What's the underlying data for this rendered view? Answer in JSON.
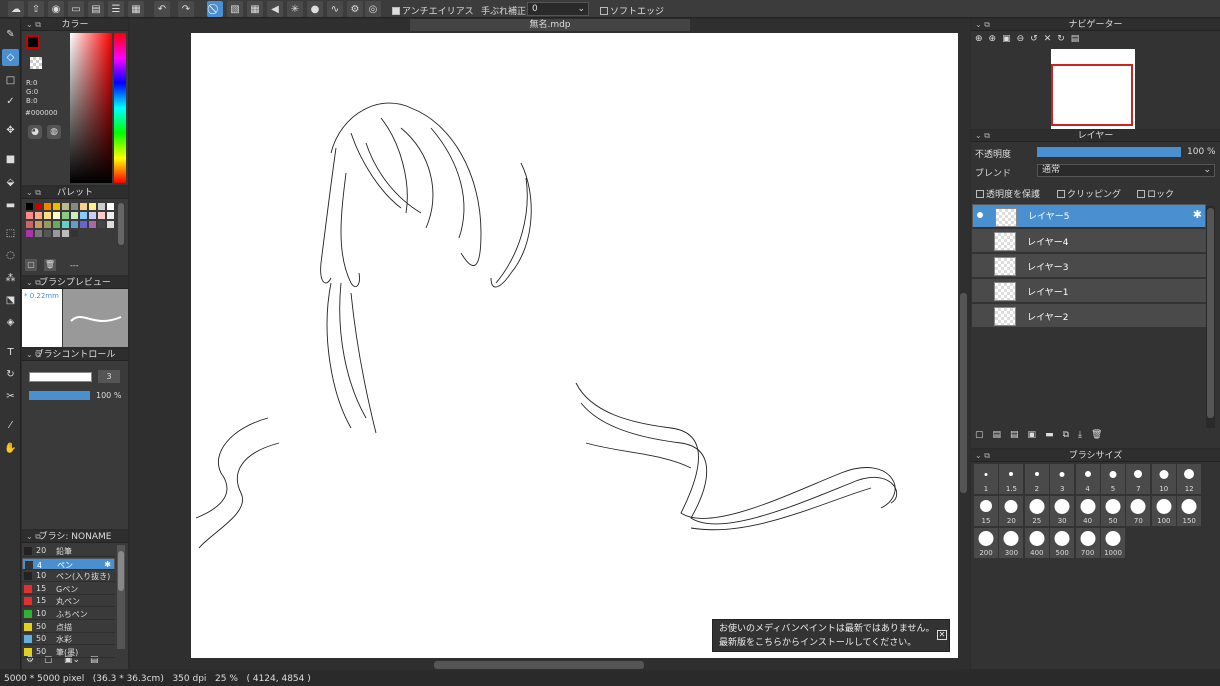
{
  "toolbar_top": {
    "antialias_label": "アンチエイリアス",
    "stabilizer_label": "手ぶれ補正",
    "stabilizer_value": "0",
    "soft_edge_label": "ソフトエッジ"
  },
  "document": {
    "tab_title": "無名.mdp"
  },
  "color_panel": {
    "title": "カラー",
    "r": "R:0",
    "g": "G:0",
    "b": "B:0",
    "hex": "#000000"
  },
  "palette_panel": {
    "title": "パレット",
    "dashes": "---"
  },
  "brush_preview": {
    "title": "ブラシプレビュー",
    "size_label": "* 0.22mm"
  },
  "brush_control": {
    "title": "ブラシコントロール",
    "size_value": "3",
    "opacity_value": "100 %"
  },
  "brush_list": {
    "title": "ブラシ: NONAME",
    "items": [
      {
        "size": "20",
        "name": "鉛筆",
        "color": "#222222"
      },
      {
        "size": "4",
        "name": "ペン",
        "color": "#333333"
      },
      {
        "size": "10",
        "name": "ペン(入り抜き)",
        "color": "#222222"
      },
      {
        "size": "15",
        "name": "Gペン",
        "color": "#e03030"
      },
      {
        "size": "15",
        "name": "丸ペン",
        "color": "#e03030"
      },
      {
        "size": "10",
        "name": "ふちペン",
        "color": "#30b030"
      },
      {
        "size": "50",
        "name": "点描",
        "color": "#e0d020"
      },
      {
        "size": "50",
        "name": "水彩",
        "color": "#60b0e0"
      },
      {
        "size": "50",
        "name": "筆(墨)",
        "color": "#e0d020"
      }
    ]
  },
  "navigator": {
    "title": "ナビゲーター"
  },
  "layer_panel": {
    "title": "レイヤー",
    "opacity_label": "不透明度",
    "opacity_value": "100 %",
    "opacity_fraction": 1.0,
    "blend_label": "ブレンド",
    "blend_value": "通常",
    "protect_alpha": "透明度を保護",
    "clipping": "クリッピング",
    "lock": "ロック",
    "layers": [
      {
        "name": "レイヤー5",
        "selected": true
      },
      {
        "name": "レイヤー4",
        "selected": false
      },
      {
        "name": "レイヤー3",
        "selected": false
      },
      {
        "name": "レイヤー1",
        "selected": false
      },
      {
        "name": "レイヤー2",
        "selected": false
      }
    ]
  },
  "brush_size_panel": {
    "title": "ブラシサイズ",
    "sizes": [
      "1",
      "1.5",
      "2",
      "3",
      "4",
      "5",
      "7",
      "10",
      "12",
      "15",
      "20",
      "25",
      "30",
      "40",
      "50",
      "70",
      "100",
      "150",
      "200",
      "300",
      "400",
      "500",
      "700",
      "1000"
    ]
  },
  "notification": {
    "line1": "お使いのメディバンペイントは最新ではありません。",
    "line2": "最新版をこちらからインストールしてください。"
  },
  "status": {
    "size": "5000 * 5000 pixel",
    "cm": "(36.3 * 36.3cm)",
    "dpi": "350 dpi",
    "zoom": "25 %",
    "coords": "( 4124, 4854 )"
  },
  "colors": {
    "accent": "#4a90d0",
    "navigator_frame": "#cc2222"
  }
}
